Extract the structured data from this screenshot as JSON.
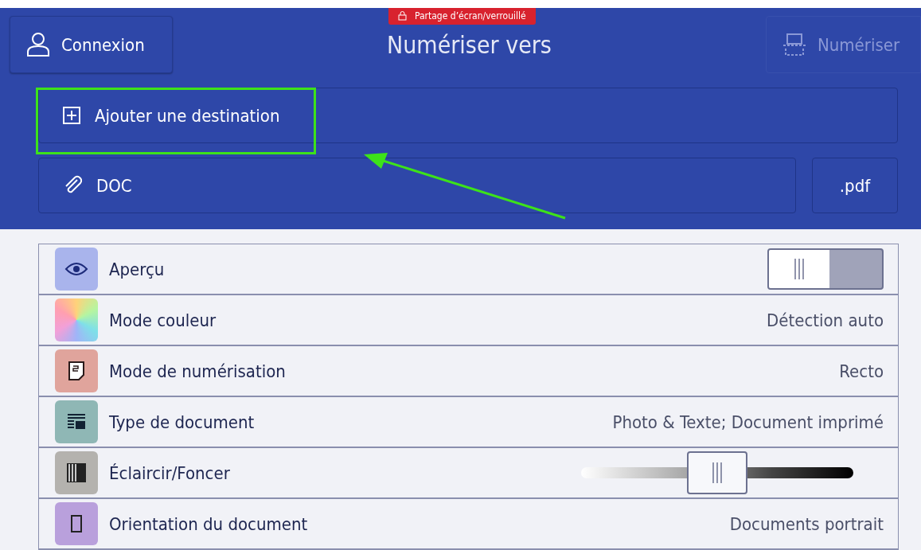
{
  "header": {
    "login_button": "Connexion",
    "title": "Numériser vers",
    "badge": "Partage d’écran/verrouillé",
    "scan_button": {
      "label": "Numériser",
      "disabled": true
    }
  },
  "destinations": {
    "add": "Ajouter une destination",
    "document": "DOC",
    "format": ".pdf"
  },
  "annotation": {
    "highlight": true
  },
  "settings": [
    {
      "kind": "toggle",
      "label": "Aperçu",
      "on": false
    },
    {
      "kind": "value",
      "label": "Mode couleur",
      "value": "Détection auto"
    },
    {
      "kind": "value",
      "label": "Mode de numérisation",
      "value": "Recto"
    },
    {
      "kind": "value",
      "label": "Type de document",
      "value": "Photo & Texte; Document imprimé"
    },
    {
      "kind": "slider",
      "label": "Éclaircir/Foncer",
      "level": 0.5
    },
    {
      "kind": "value",
      "label": "Orientation du document",
      "value": "Documents portrait"
    }
  ]
}
